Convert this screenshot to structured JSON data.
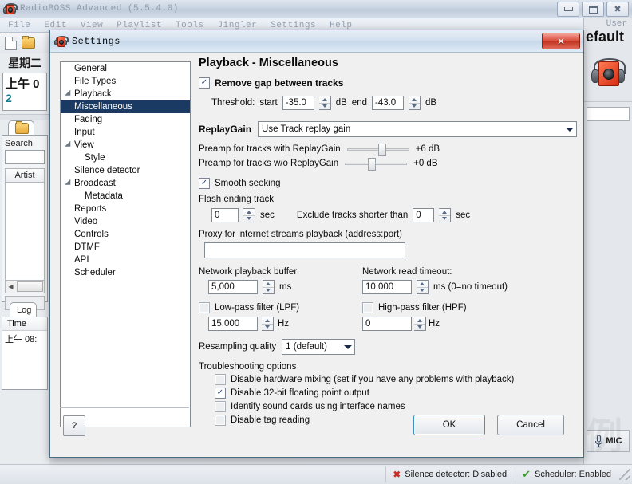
{
  "main_window": {
    "title": "RadioBOSS Advanced (5.5.4.0)",
    "icon": "radio-icon",
    "window_controls": {
      "minimize": "minimize-icon",
      "maximize": "maximize-icon",
      "close": "close-icon"
    },
    "menu": [
      "File",
      "Edit",
      "View",
      "Playlist",
      "Tools",
      "Jingler",
      "Settings",
      "Help"
    ],
    "left_panel": {
      "new_icon": "new-file-icon",
      "open_icon": "open-folder-icon",
      "date": "星期二",
      "clock_time": "上午 0",
      "clock_sub": "2",
      "tab_icon": "folder-tab-icon",
      "search_label": "Search",
      "search_value": "",
      "artist_column": "Artist",
      "log_tab": "Log",
      "log_time_column": "Time",
      "log_first_row": "上午 08:"
    },
    "right_panel": {
      "user_label": "User",
      "profile_name": "efault",
      "logo": "radio-logo-icon",
      "mic_label": "MIC",
      "mic_icon": "microphone-icon"
    },
    "statusbar": {
      "silence_detector": "Silence detector: Disabled",
      "silence_icon": "red-x-icon",
      "scheduler": "Scheduler: Enabled",
      "scheduler_icon": "green-check-icon"
    }
  },
  "dialog": {
    "title": "Settings",
    "icon": "radio-icon",
    "close_label": "✕",
    "tree": [
      {
        "label": "General",
        "indent": 0,
        "expander": false,
        "selected": false
      },
      {
        "label": "File Types",
        "indent": 0,
        "expander": false,
        "selected": false
      },
      {
        "label": "Playback",
        "indent": 0,
        "expander": true,
        "selected": false
      },
      {
        "label": "Miscellaneous",
        "indent": 1,
        "expander": false,
        "selected": true
      },
      {
        "label": "Fading",
        "indent": 1,
        "expander": false,
        "selected": false
      },
      {
        "label": "Input",
        "indent": 0,
        "expander": false,
        "selected": false
      },
      {
        "label": "View",
        "indent": 0,
        "expander": true,
        "selected": false
      },
      {
        "label": "Style",
        "indent": 2,
        "expander": false,
        "selected": false
      },
      {
        "label": "Silence detector",
        "indent": 0,
        "expander": false,
        "selected": false
      },
      {
        "label": "Broadcast",
        "indent": 0,
        "expander": true,
        "selected": false
      },
      {
        "label": "Metadata",
        "indent": 2,
        "expander": false,
        "selected": false
      },
      {
        "label": "Reports",
        "indent": 0,
        "expander": false,
        "selected": false
      },
      {
        "label": "Video",
        "indent": 0,
        "expander": false,
        "selected": false
      },
      {
        "label": "Controls",
        "indent": 0,
        "expander": false,
        "selected": false
      },
      {
        "label": "DTMF",
        "indent": 0,
        "expander": false,
        "selected": false
      },
      {
        "label": "API",
        "indent": 0,
        "expander": false,
        "selected": false
      },
      {
        "label": "Scheduler",
        "indent": 0,
        "expander": false,
        "selected": false
      }
    ],
    "pane": {
      "title": "Playback - Miscellaneous",
      "remove_gap": {
        "label": "Remove gap between tracks",
        "checked": true,
        "threshold_label": "Threshold:",
        "start_label": "start",
        "start_value": "-35.0",
        "start_unit": "dB",
        "end_label": "end",
        "end_value": "-43.0",
        "end_unit": "dB"
      },
      "replaygain": {
        "label": "ReplayGain",
        "selected_option": "Use Track replay gain",
        "with_label": "Preamp for tracks with ReplayGain",
        "with_value": "+6 dB",
        "with_pct": 55,
        "without_label": "Preamp for tracks w/o ReplayGain",
        "without_value": "+0 dB",
        "without_pct": 42
      },
      "smooth_seeking": {
        "label": "Smooth seeking",
        "checked": true
      },
      "flash_ending": {
        "label": "Flash ending track",
        "value": "0",
        "unit": "sec",
        "exclude_label": "Exclude tracks shorter than",
        "exclude_value": "0",
        "exclude_unit": "sec"
      },
      "proxy": {
        "label": "Proxy for internet streams playback (address:port)",
        "value": ""
      },
      "network": {
        "buffer_label": "Network playback buffer",
        "buffer_value": "5,000",
        "buffer_unit": "ms",
        "timeout_label": "Network read timeout:",
        "timeout_value": "10,000",
        "timeout_unit": "ms (0=no timeout)"
      },
      "filters": {
        "lpf_label": "Low-pass filter (LPF)",
        "lpf_checked": false,
        "lpf_value": "15,000",
        "lpf_unit": "Hz",
        "hpf_label": "High-pass filter (HPF)",
        "hpf_checked": false,
        "hpf_value": "0",
        "hpf_unit": "Hz"
      },
      "resampling": {
        "label": "Resampling quality",
        "selected_option": "1 (default)"
      },
      "troubleshooting": {
        "title": "Troubleshooting options",
        "options": [
          {
            "label": "Disable hardware mixing (set if you have any problems with playback)",
            "checked": false
          },
          {
            "label": "Disable 32-bit floating point output",
            "checked": true
          },
          {
            "label": "Identify sound cards using interface names",
            "checked": false
          },
          {
            "label": "Disable tag reading",
            "checked": false
          }
        ]
      }
    },
    "footer": {
      "help_label": "?",
      "ok_label": "OK",
      "cancel_label": "Cancel"
    }
  }
}
